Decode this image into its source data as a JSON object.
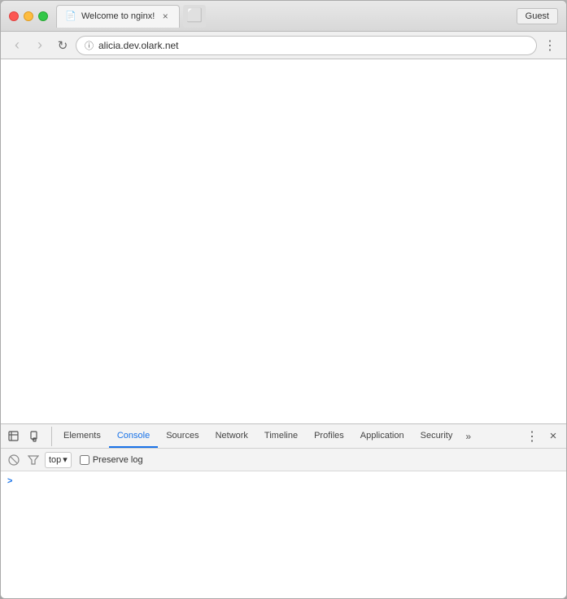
{
  "browser": {
    "traffic_lights": {
      "close_label": "close",
      "minimize_label": "minimize",
      "maximize_label": "maximize"
    },
    "tab": {
      "favicon_symbol": "📄",
      "title": "Welcome to nginx!",
      "close_symbol": "×"
    },
    "new_tab_symbol": "",
    "guest_button": "Guest",
    "nav": {
      "back_symbol": "‹",
      "forward_symbol": "›",
      "reload_symbol": "↻",
      "address": "alicia.dev.olark.net",
      "menu_symbol": "⋮"
    }
  },
  "devtools": {
    "icon1_symbol": "⊡",
    "icon2_symbol": "□",
    "tabs": [
      {
        "label": "Elements",
        "active": false
      },
      {
        "label": "Console",
        "active": true
      },
      {
        "label": "Sources",
        "active": false
      },
      {
        "label": "Network",
        "active": false
      },
      {
        "label": "Timeline",
        "active": false
      },
      {
        "label": "Profiles",
        "active": false
      },
      {
        "label": "Application",
        "active": false
      },
      {
        "label": "Security",
        "active": false
      }
    ],
    "overflow_symbol": "»",
    "more_symbol": "⋮",
    "close_symbol": "×"
  },
  "console": {
    "clear_symbol": "🚫",
    "filter_symbol": "⊘",
    "filter_value": "top",
    "filter_arrow": "▾",
    "preserve_log_label": "Preserve log",
    "prompt_symbol": ">",
    "cursor_char": "▎"
  }
}
